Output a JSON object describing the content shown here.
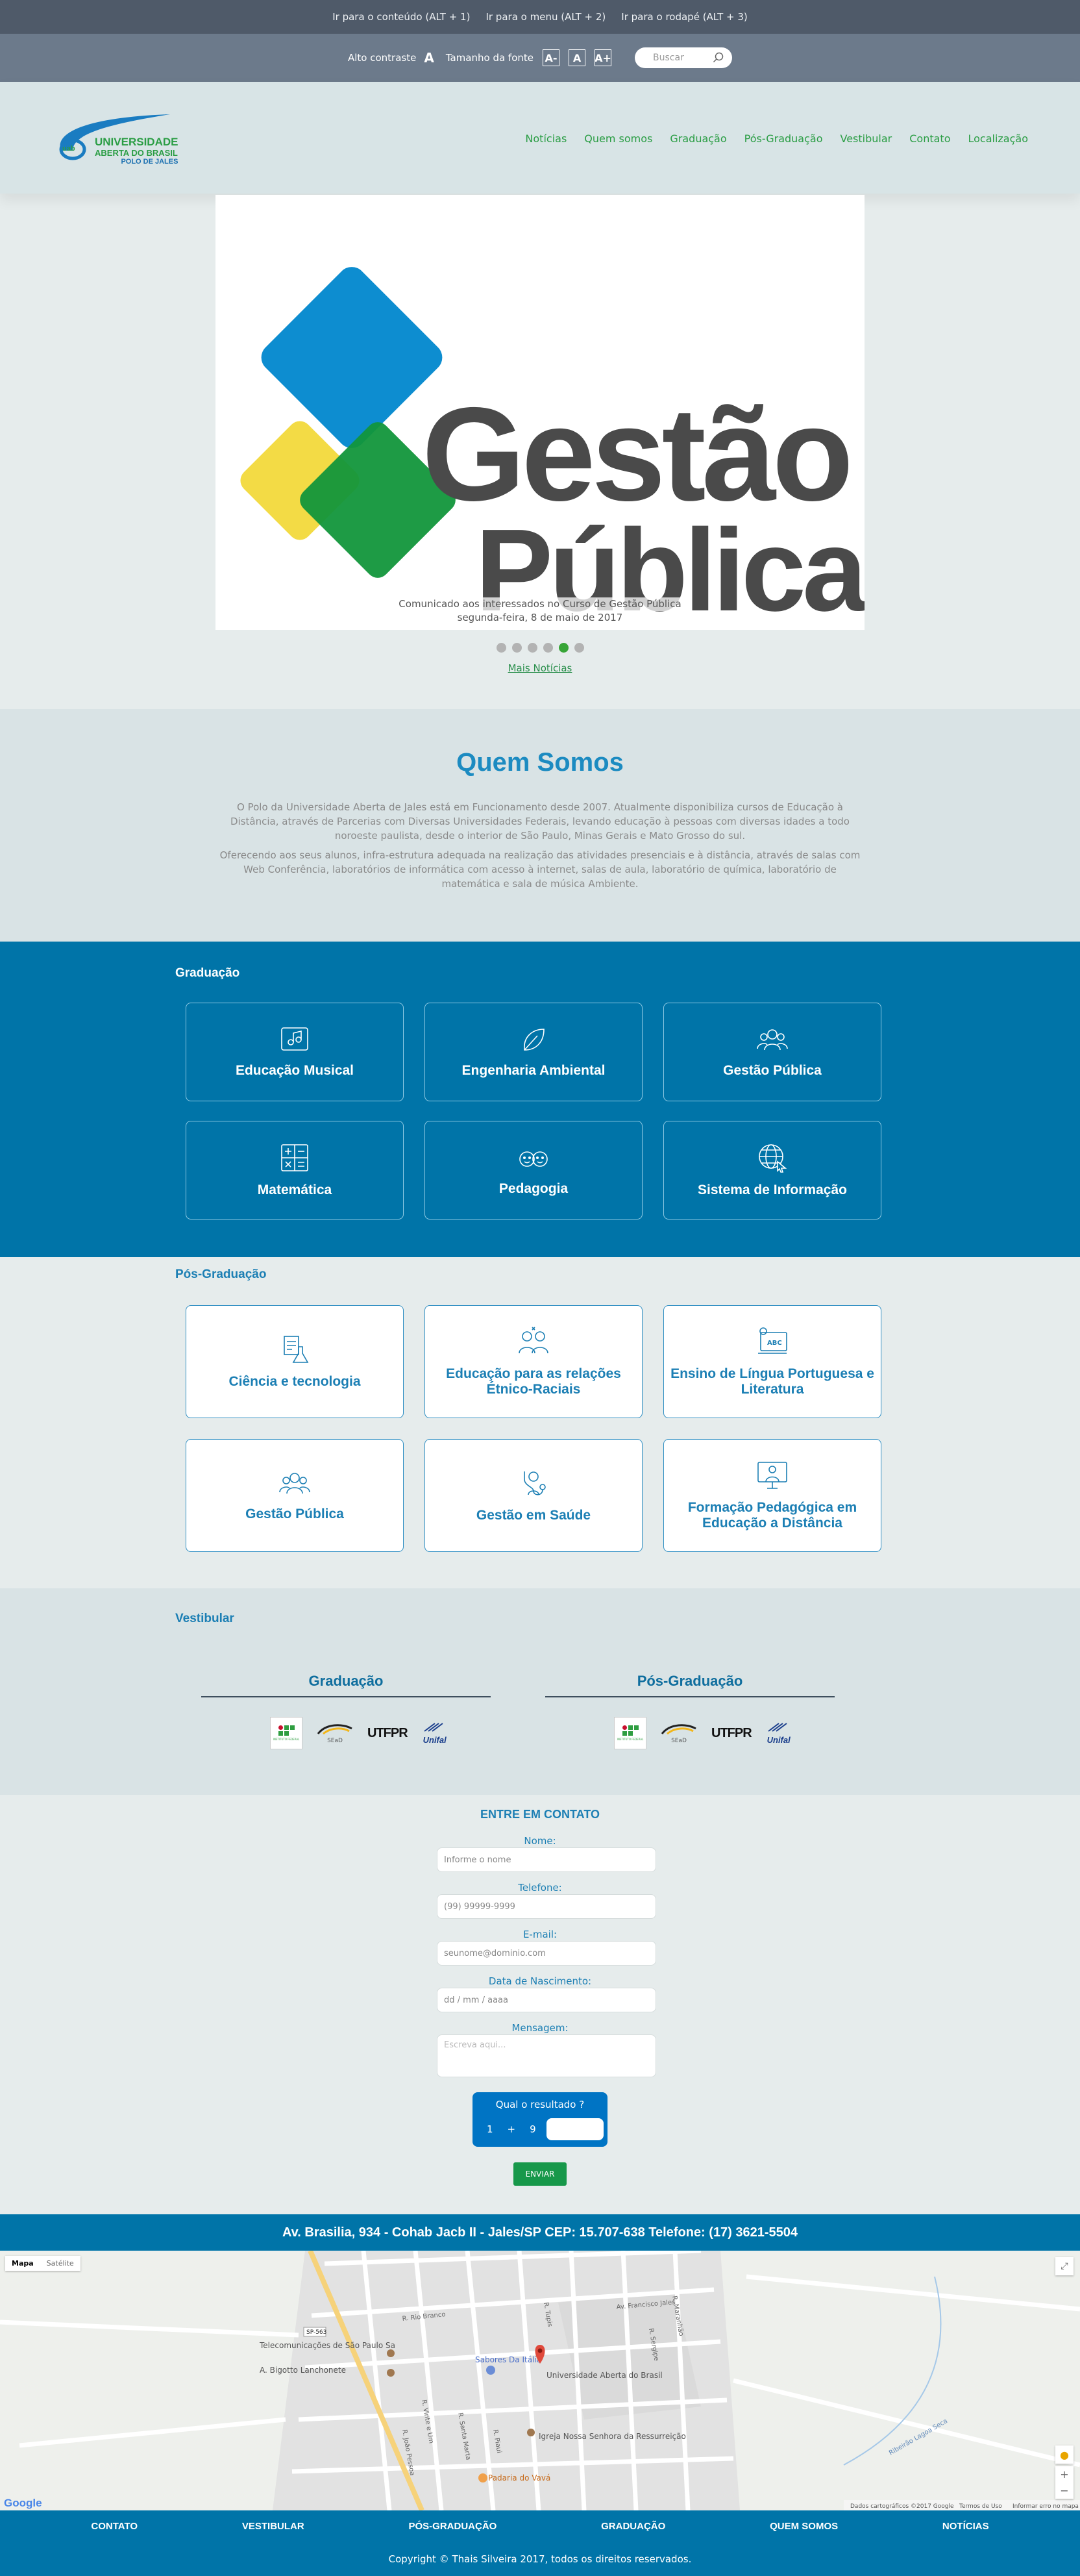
{
  "accessibility": {
    "links": [
      "Ir para o conteúdo (ALT + 1)",
      "Ir para o menu (ALT + 2)",
      "Ir para o rodapé (ALT + 3)"
    ],
    "contrast_label": "Alto contraste",
    "font_size_label": "Tamanho da fonte",
    "font_buttons": [
      "A-",
      "A",
      "A+"
    ],
    "search_placeholder": "Buscar"
  },
  "header": {
    "logo_line1": "UNIVERSIDADE",
    "logo_line2": "ABERTA DO BRASIL",
    "logo_line3": "POLO DE JALES",
    "logo_badge": "uab",
    "nav": [
      "Notícias",
      "Quem somos",
      "Graduação",
      "Pós-Graduação",
      "Vestibular",
      "Contato",
      "Localização"
    ]
  },
  "carousel": {
    "image_title_line1": "Gestão",
    "image_title_line2": "Pública",
    "caption": "Comunicado aos interessados no Curso de Gestão Pública",
    "date": "segunda-feira, 8 de maio de 2017",
    "dots_total": 6,
    "dots_active": 5,
    "more_link": "Mais Notícias"
  },
  "quem_somos": {
    "title": "Quem Somos",
    "p1": "O Polo da Universidade Aberta de Jales está em Funcionamento desde 2007. Atualmente disponibiliza cursos de Educação à Distância, através de Parcerias com Diversas Universidades Federais, levando educação à pessoas com diversas idades a todo noroeste paulista, desde o interior de São Paulo, Minas Gerais e Mato Grosso do sul.",
    "p2": "Oferecendo aos seus alunos, infra-estrutura adequada na realização das atividades presenciais e à distância, através de salas com Web Conferência, laboratórios de informática com acesso à internet, salas de aula, laboratório de química, laboratório de matemática e sala de música Ambiente."
  },
  "graduacao": {
    "title": "Graduação",
    "courses": [
      {
        "label": "Educação Musical",
        "icon": "music-icon"
      },
      {
        "label": "Engenharia Ambiental",
        "icon": "leaf-icon"
      },
      {
        "label": "Gestão Pública",
        "icon": "people-icon"
      },
      {
        "label": "Matemática",
        "icon": "calculator-icon"
      },
      {
        "label": "Pedagogia",
        "icon": "children-icon"
      },
      {
        "label": "Sistema de Informação",
        "icon": "globe-cursor-icon"
      }
    ]
  },
  "pos_graduacao": {
    "title": "Pós-Graduação",
    "courses": [
      {
        "label": "Ciência e tecnologia",
        "icon": "lab-icon"
      },
      {
        "label": "Educação para as relações Étnico-Raciais",
        "icon": "diversity-icon"
      },
      {
        "label": "Ensino de Língua Portuguesa e Literatura",
        "icon": "abc-board-icon"
      },
      {
        "label": "Gestão Pública",
        "icon": "people-icon"
      },
      {
        "label": "Gestão em Saúde",
        "icon": "stethoscope-icon"
      },
      {
        "label": "Formação Pedagógica em Educação a Distância",
        "icon": "computer-teacher-icon"
      }
    ]
  },
  "vestibular": {
    "title": "Vestibular",
    "col1": "Graduação",
    "col2": "Pós-Graduação",
    "logos": [
      "INSTITUTO FEDERAL",
      "SEaD",
      "UTFPR",
      "Unifal"
    ]
  },
  "contato": {
    "title": "ENTRE EM CONTATO",
    "fields": [
      {
        "label": "Nome:",
        "placeholder": "Informe o nome"
      },
      {
        "label": "Telefone:",
        "placeholder": "(99) 99999-9999"
      },
      {
        "label": "E-mail:",
        "placeholder": "seunome@dominio.com"
      },
      {
        "label": "Data de Nascimento:",
        "placeholder": "dd / mm / aaaa"
      },
      {
        "label": "Mensagem:",
        "placeholder": "Escreva aqui..."
      }
    ],
    "captcha_title": "Qual o resultado ?",
    "captcha_a": "1",
    "captcha_op": "+",
    "captcha_b": "9",
    "send": "ENVIAR"
  },
  "address": "Av. Brasilia, 934 - Cohab Jacb II - Jales/SP CEP: 15.707-638 Telefone: (17) 3621-5504",
  "map": {
    "type_buttons": [
      "Mapa",
      "Satélite"
    ],
    "places": [
      "Telecomunicações de São Paulo Sa",
      "A. Bigotto Lanchonete",
      "Sabores Da Itália",
      "Universidade Aberta do Brasil",
      "Igreja Nossa Senhora da Ressurreição",
      "Padaria do Vavá",
      "Ribeirão Lagoa Seca"
    ],
    "streets": [
      "R. Rio Branco",
      "R. Vinte e Um",
      "R. Santa Marta",
      "R. João Pessoa",
      "R. Piaui",
      "R. Sergipe",
      "Av. Francisco Jales",
      "R. Tupis",
      "R. Maranhão"
    ],
    "road_shield": "SP-563",
    "attribution": [
      "Dados cartográficos ©2017 Google",
      "Termos de Uso",
      "Informar erro no mapa"
    ],
    "google": "Google"
  },
  "footer": {
    "nav": [
      "CONTATO",
      "VESTIBULAR",
      "PÓS-GRADUAÇÃO",
      "GRADUAÇÃO",
      "QUEM SOMOS",
      "NOTÍCIAS"
    ],
    "copyright": "Copyright © Thais Silveira 2017, todos os direitos reservados."
  },
  "colors": {
    "accent_blue": "#0074a8",
    "brand_green": "#2a9d44",
    "access_bar": "#4f5a69"
  }
}
